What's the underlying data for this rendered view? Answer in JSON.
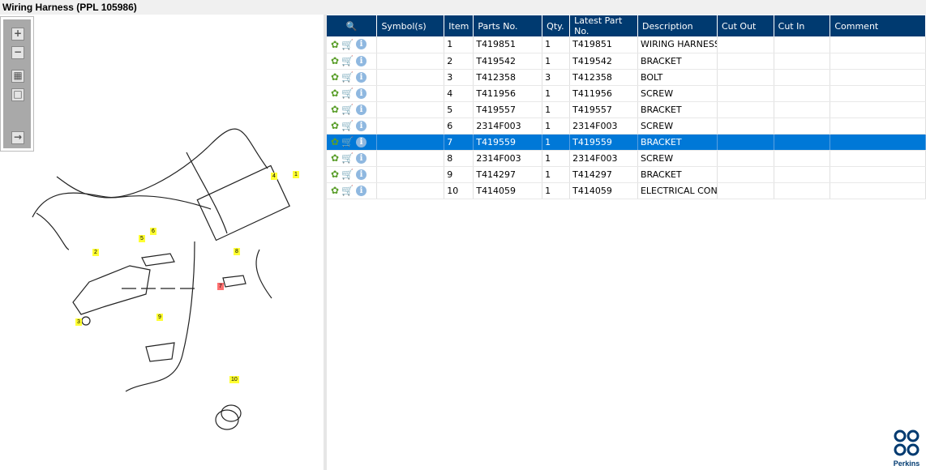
{
  "title": "Wiring Harness (PPL 105986)",
  "toolbar": {
    "zoom_in": "+",
    "zoom_out": "−",
    "fit": "▦",
    "reset": "□",
    "export": "→"
  },
  "callouts": [
    "1",
    "2",
    "3",
    "4",
    "5",
    "6",
    "7",
    "8",
    "9",
    "10"
  ],
  "table": {
    "headers": [
      "Symbol(s)",
      "Item",
      "Parts No.",
      "Qty.",
      "Latest Part No.",
      "Description",
      "Cut Out",
      "Cut In",
      "Comment"
    ],
    "rows": [
      {
        "item": "1",
        "part": "T419851",
        "qty": "1",
        "latest": "T419851",
        "desc": "WIRING HARNESS"
      },
      {
        "item": "2",
        "part": "T419542",
        "qty": "1",
        "latest": "T419542",
        "desc": "BRACKET"
      },
      {
        "item": "3",
        "part": "T412358",
        "qty": "3",
        "latest": "T412358",
        "desc": "BOLT"
      },
      {
        "item": "4",
        "part": "T411956",
        "qty": "1",
        "latest": "T411956",
        "desc": "SCREW"
      },
      {
        "item": "5",
        "part": "T419557",
        "qty": "1",
        "latest": "T419557",
        "desc": "BRACKET"
      },
      {
        "item": "6",
        "part": "2314F003",
        "qty": "1",
        "latest": "2314F003",
        "desc": "SCREW"
      },
      {
        "item": "7",
        "part": "T419559",
        "qty": "1",
        "latest": "T419559",
        "desc": "BRACKET",
        "selected": true
      },
      {
        "item": "8",
        "part": "2314F003",
        "qty": "1",
        "latest": "2314F003",
        "desc": "SCREW"
      },
      {
        "item": "9",
        "part": "T414297",
        "qty": "1",
        "latest": "T414297",
        "desc": "BRACKET"
      },
      {
        "item": "10",
        "part": "T414059",
        "qty": "1",
        "latest": "T414059",
        "desc": "ELECTRICAL CONN"
      }
    ]
  },
  "logo": {
    "text": "Perkins"
  },
  "colors": {
    "header": "#003a70",
    "selected": "#0078d7"
  }
}
